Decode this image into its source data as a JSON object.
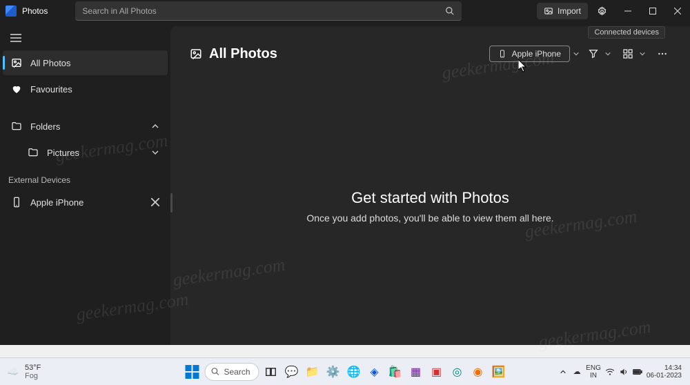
{
  "app": {
    "title": "Photos"
  },
  "search": {
    "placeholder": "Search in All Photos"
  },
  "title_buttons": {
    "import": "Import"
  },
  "sidebar": {
    "all_photos": "All Photos",
    "favourites": "Favourites",
    "folders": "Folders",
    "pictures": "Pictures",
    "external_label": "External Devices",
    "device": "Apple iPhone"
  },
  "main": {
    "heading": "All Photos",
    "tooltip": "Connected devices",
    "device_btn": "Apple iPhone",
    "empty_title": "Get started with Photos",
    "empty_sub": "Once you add photos, you'll be able to view them all here."
  },
  "taskbar": {
    "temp": "53°F",
    "cond": "Fog",
    "search": "Search",
    "lang1": "ENG",
    "lang2": "IN",
    "time": "14:34",
    "date": "06-01-2023"
  },
  "watermark": "geekermag.com"
}
